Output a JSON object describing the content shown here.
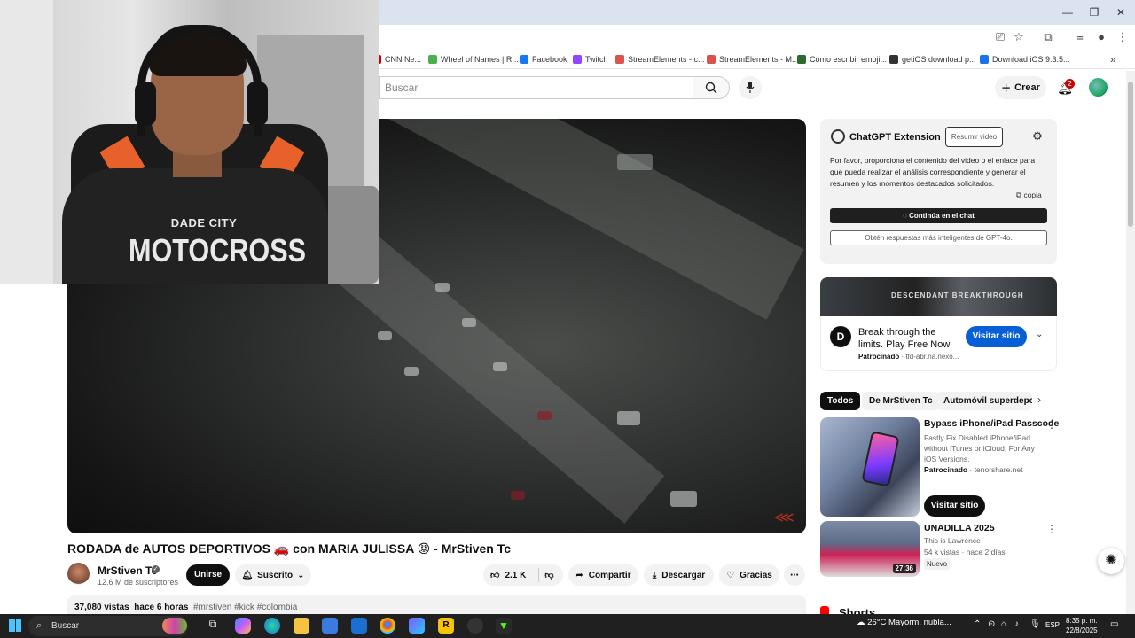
{
  "browser": {
    "bookmarks": [
      {
        "label": "CNN Ne...",
        "color": "#cc0000"
      },
      {
        "label": "Wheel of Names | R...",
        "color": "#4caf50"
      },
      {
        "label": "Facebook",
        "color": "#1877f2"
      },
      {
        "label": "Twitch",
        "color": "#9146ff"
      },
      {
        "label": "StreamElements - c...",
        "color": "#d9534f"
      },
      {
        "label": "StreamElements - M...",
        "color": "#d9534f"
      },
      {
        "label": "Cómo escribir emoji...",
        "color": "#2d6a2d"
      },
      {
        "label": "getiOS download p...",
        "color": "#333333"
      },
      {
        "label": "Download iOS 9.3.5...",
        "color": "#1a73e8"
      }
    ],
    "more_bookmarks": "»"
  },
  "header": {
    "search_placeholder": "Buscar",
    "create_label": "Crear",
    "notifications_count": "2"
  },
  "webcam": {
    "shirt_line1": "DADE CITY",
    "shirt_line2": "MOTOCROSS"
  },
  "video": {
    "title": "RODADA de AUTOS DEPORTIVOS 🚗 con MARIA JULISSA 😡 - MrStiven Tc",
    "channel": "MrStiven Tc",
    "subscribers": "12.6 M de suscriptores",
    "join_label": "Unirse",
    "subscribed_label": "Suscrito",
    "likes": "2.1 K",
    "share_label": "Compartir",
    "download_label": "Descargar",
    "thanks_label": "Gracias",
    "views": "37,080 vistas",
    "age": "hace 6 horas",
    "tags": "#mrstiven #kick #colombia"
  },
  "gpt_extension": {
    "title": "ChatGPT Extension",
    "summarize_label": "Resumir video",
    "message": "Por favor, proporciona el contenido del video o el enlace para que pueda realizar el análisis correspondiente y generar el resumen y los momentos destacados solicitados.",
    "copy_label": "copia",
    "continue_label": "Continúa en el chat",
    "better_label": "Obtén respuestas más inteligentes de GPT-4o."
  },
  "ad": {
    "banner_text": "DESCENDANT BREAKTHROUGH",
    "title": "Break through the limits. Play Free Now",
    "sponsored": "Patrocinado",
    "domain": "tfd-abr.na.nexo...",
    "visit_label": "Visitar sitio"
  },
  "chips": [
    "Todos",
    "De MrStiven Tc",
    "Automóvil superdepor"
  ],
  "recommendations": [
    {
      "title": "Bypass iPhone/iPad Passcode",
      "desc": "Fastly Fix Disabled iPhone/iPad without iTunes or iCloud, For Any iOS Versions.",
      "sponsored": "Patrocinado",
      "domain": "tenorshare.net",
      "visit_label": "Visitar sitio"
    },
    {
      "title": "UNADILLA 2025",
      "channel": "This is Lawrence",
      "meta": "54 k vistas · hace 2 días",
      "badge": "Nuevo",
      "duration": "27:36"
    }
  ],
  "shorts_label": "Shorts",
  "taskbar": {
    "search_label": "Buscar",
    "weather": "26°C  Mayorm. nubla...",
    "lang": "ESP",
    "time": "8:35 p. m.",
    "date": "22/8/2025"
  }
}
